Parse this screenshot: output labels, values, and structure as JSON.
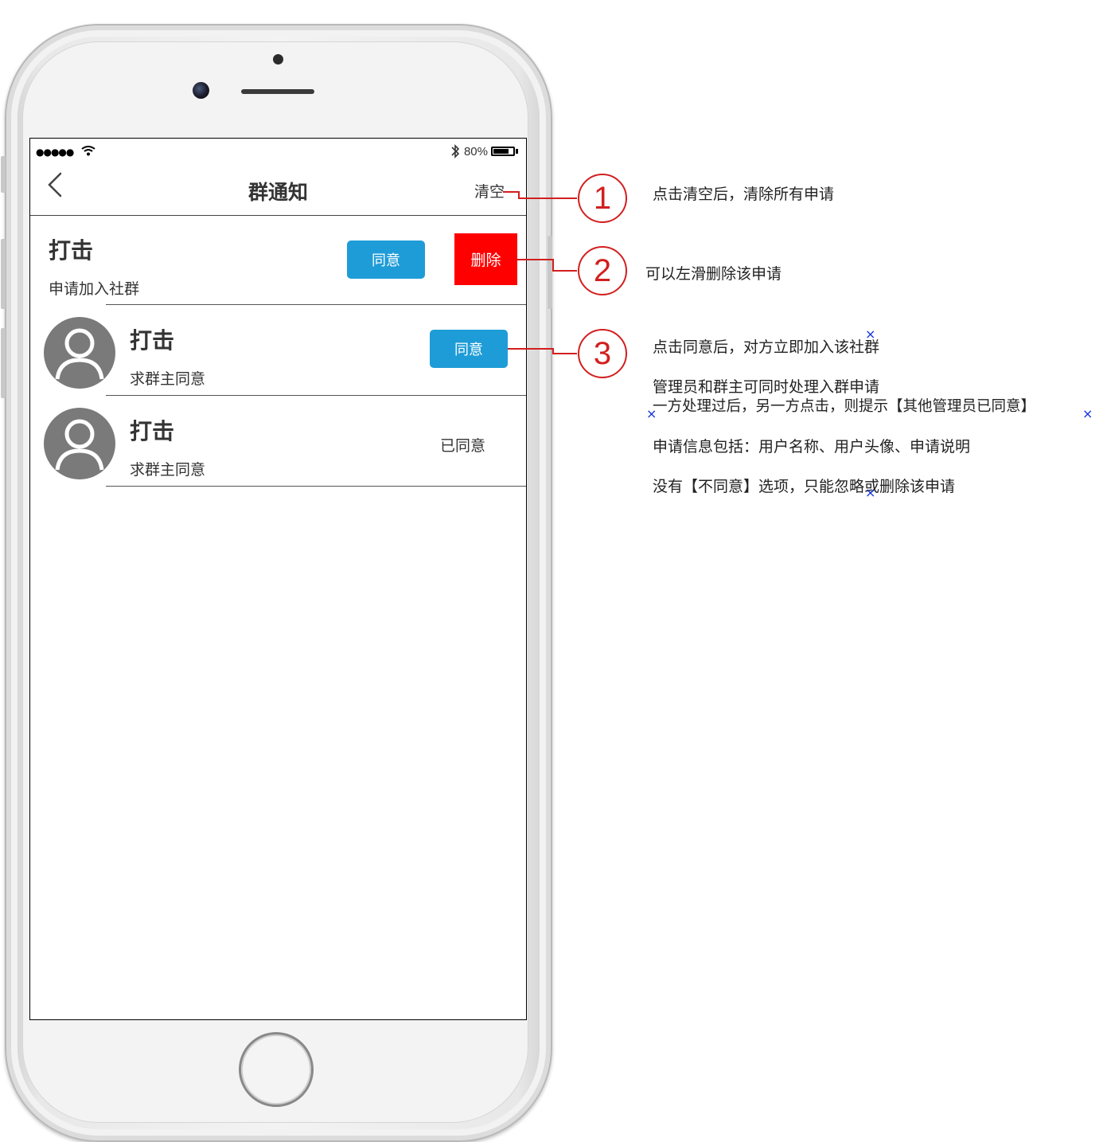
{
  "status_bar": {
    "signal": "●●●●●",
    "battery_percent": "80%",
    "battery_level": 0.8
  },
  "nav": {
    "title": "群通知",
    "clear_label": "清空"
  },
  "requests": [
    {
      "name": "打击",
      "message": "申请加入社群",
      "action_label": "同意",
      "delete_label": "删除"
    },
    {
      "name": "打击",
      "message": "求群主同意",
      "action_label": "同意"
    },
    {
      "name": "打击",
      "message": "求群主同意",
      "status_label": "已同意"
    }
  ],
  "annotations": {
    "badge_1": "1",
    "badge_2": "2",
    "badge_3": "3",
    "note_1": "点击清空后，清除所有申请",
    "note_2": "可以左滑删除该申请",
    "note_3": "点击同意后，对方立即加入该社群",
    "note_4": "管理员和群主可同时处理入群申请",
    "note_5": "一方处理过后，另一方点击，则提示【其他管理员已同意】",
    "note_6": "申请信息包括：用户名称、用户头像、申请说明",
    "note_7": "没有【不同意】选项，只能忽略或删除该申请"
  },
  "colors": {
    "accent_blue": "#1e9cd7",
    "delete_red": "#ff0000",
    "annotation_red": "#d21f1f",
    "marker_blue": "#1030e0"
  }
}
